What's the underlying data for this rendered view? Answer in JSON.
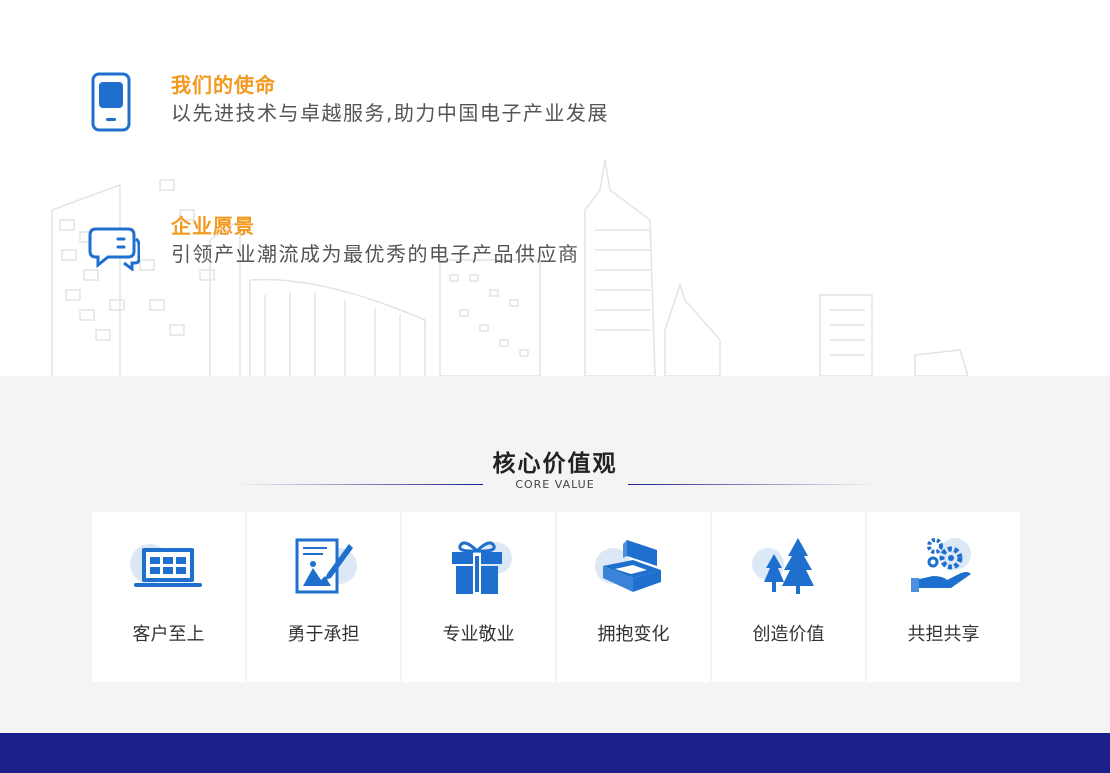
{
  "mission": {
    "title": "我们的使命",
    "description": "以先进技术与卓越服务,助力中国电子产业发展",
    "icon": "smartphone-icon"
  },
  "vision": {
    "title": "企业愿景",
    "description": "引领产业潮流成为最优秀的电子产品供应商",
    "icon": "chat-bubbles-icon"
  },
  "core_values": {
    "title": "核心价值观",
    "subtitle": "CORE VALUE",
    "items": [
      {
        "label": "客户至上",
        "icon": "laptop-icon"
      },
      {
        "label": "勇于承担",
        "icon": "document-pen-icon"
      },
      {
        "label": "专业敬业",
        "icon": "gift-icon"
      },
      {
        "label": "拥抱变化",
        "icon": "boxes-icon"
      },
      {
        "label": "创造价值",
        "icon": "trees-icon"
      },
      {
        "label": "共担共享",
        "icon": "gears-hand-icon"
      }
    ]
  },
  "colors": {
    "accent_orange": "#f29a1f",
    "icon_blue": "#1f6fcf",
    "footer_navy": "#1b1f8a"
  }
}
